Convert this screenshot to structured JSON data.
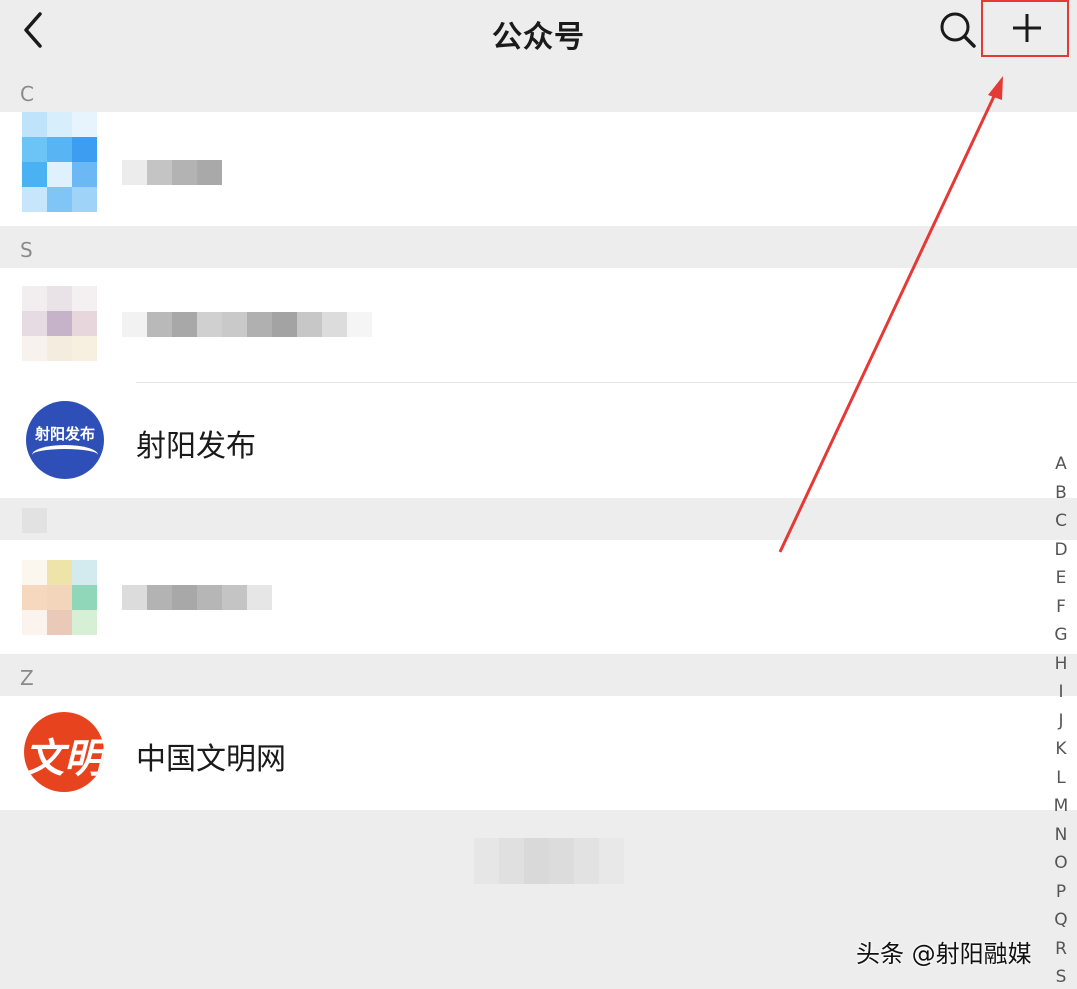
{
  "header": {
    "title": "公众号",
    "back_icon": "chevron-left-icon",
    "search_icon": "search-icon",
    "add_icon": "plus-icon",
    "highlight_color": "#e53935"
  },
  "sections": [
    {
      "letter": "C"
    },
    {
      "letter": "S"
    },
    {
      "letter": "Z"
    }
  ],
  "accounts": [
    {
      "name": "射阳发布",
      "avatar_text": "射阳发布",
      "avatar_color": "#2e4fb8"
    },
    {
      "name": "中国文明网",
      "avatar_text": "文明",
      "avatar_color": "#e8431f"
    }
  ],
  "alphabet_index": [
    "A",
    "B",
    "C",
    "D",
    "E",
    "F",
    "G",
    "H",
    "I",
    "J",
    "K",
    "L",
    "M",
    "N",
    "O",
    "P",
    "Q",
    "R",
    "S"
  ],
  "watermark": "头条 @射阳融媒",
  "annotation": {
    "arrow_color": "#e53935"
  }
}
